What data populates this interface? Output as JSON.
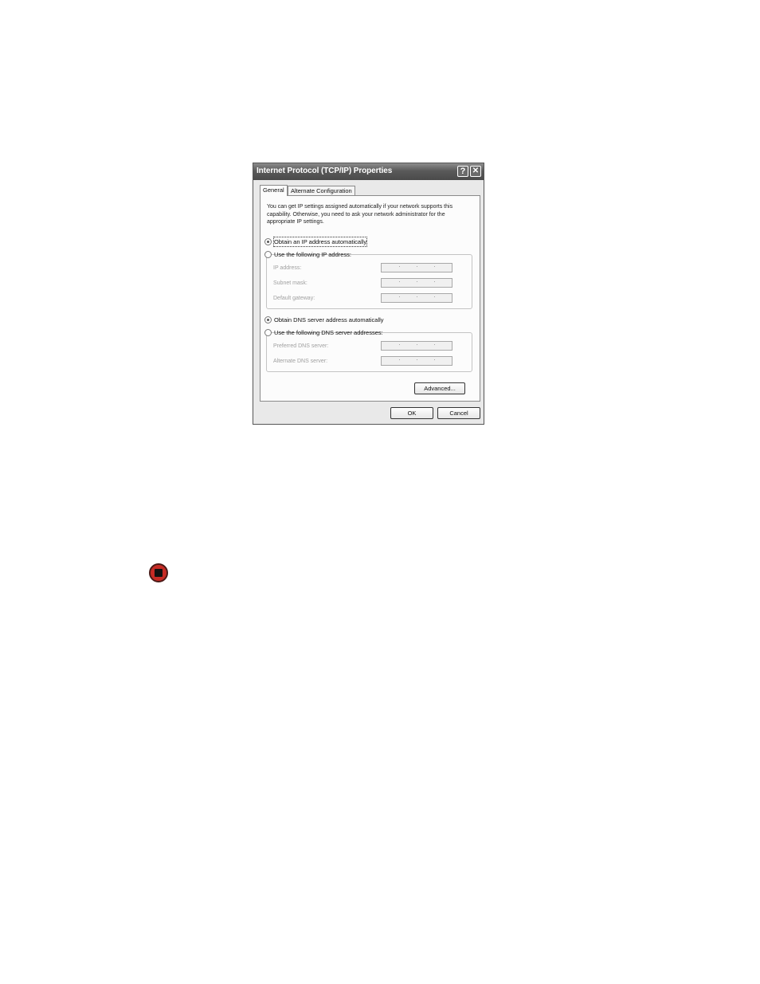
{
  "dialog": {
    "title": "Internet Protocol (TCP/IP) Properties",
    "help_glyph": "?",
    "close_glyph": "✕",
    "tabs": [
      {
        "label": "General",
        "active": true
      },
      {
        "label": "Alternate Configuration",
        "active": false
      }
    ],
    "intro_text": "You can get IP settings assigned automatically if your network supports this capability. Otherwise, you need to ask your network administrator for the appropriate IP settings.",
    "ip_options": {
      "auto_label": "Obtain an IP address automatically",
      "manual_label": "Use the following IP address:",
      "selected": "auto"
    },
    "ip_fields": {
      "ip_address_label": "IP address:",
      "subnet_mask_label": "Subnet mask:",
      "default_gateway_label": "Default gateway:",
      "enabled": false
    },
    "dns_options": {
      "auto_label": "Obtain DNS server address automatically",
      "manual_label": "Use the following DNS server addresses:",
      "selected": "auto"
    },
    "dns_fields": {
      "preferred_label": "Preferred DNS server:",
      "alternate_label": "Alternate DNS server:",
      "enabled": false
    },
    "buttons": {
      "advanced": "Advanced...",
      "ok": "OK",
      "cancel": "Cancel"
    }
  },
  "page_icons": {
    "stop_icon": "stop-icon",
    "stop_color": "#c62b25"
  }
}
